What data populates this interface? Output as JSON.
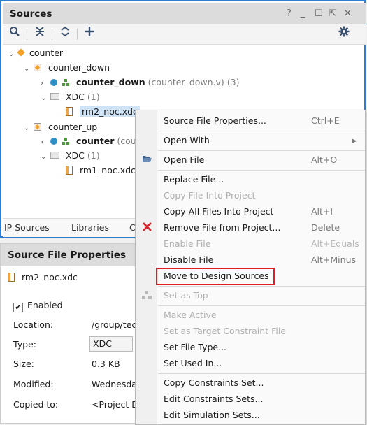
{
  "sources": {
    "title": "Sources",
    "header_controls": [
      "?",
      "_",
      "☐",
      "⇱",
      "✕"
    ],
    "toolbar_icons": [
      "search-icon",
      "collapse-all-icon",
      "expand-all-icon",
      "add-icon",
      "gear-icon"
    ],
    "tree": {
      "root": "counter",
      "counter_down": "counter_down",
      "counter_down_module": "counter_down",
      "counter_down_file": "(counter_down.v) (3)",
      "xdc1": "XDC",
      "xdc1_count": "(1)",
      "file1": "rm2_noc.xdc",
      "counter_up": "counter_up",
      "counter_up_module": "counter",
      "counter_up_file": "(coun",
      "xdc2": "XDC",
      "xdc2_count": "(1)",
      "file2": "rm1_noc.xdc"
    },
    "tabs": [
      "IP Sources",
      "Libraries",
      "C"
    ]
  },
  "properties": {
    "title": "Source File Properties",
    "file_name": "rm2_noc.xdc",
    "enabled_label": "Enabled",
    "enabled_checked": "✔",
    "location_label": "Location:",
    "location_value": "/group/tec",
    "type_label": "Type:",
    "type_value": "XDC",
    "size_label": "Size:",
    "size_value": "0.3 KB",
    "modified_label": "Modified:",
    "modified_value": "Wednesda",
    "copied_label": "Copied to:",
    "copied_value": "<Project D"
  },
  "context_menu": {
    "items": [
      {
        "label": "Source File Properties...",
        "shortcut": "Ctrl+E"
      },
      {
        "label": "Open With",
        "shortcut": "▸"
      },
      {
        "label": "Open File",
        "shortcut": "Alt+O"
      },
      {
        "label": "Replace File...",
        "shortcut": ""
      },
      {
        "label": "Copy File Into Project",
        "shortcut": ""
      },
      {
        "label": "Copy All Files Into Project",
        "shortcut": "Alt+I"
      },
      {
        "label": "Remove File from Project...",
        "shortcut": "Delete"
      },
      {
        "label": "Enable File",
        "shortcut": "Alt+Equals"
      },
      {
        "label": "Disable File",
        "shortcut": "Alt+Minus"
      },
      {
        "label": "Move to Design Sources",
        "shortcut": ""
      },
      {
        "label": "Set as Top",
        "shortcut": ""
      },
      {
        "label": "Make Active",
        "shortcut": ""
      },
      {
        "label": "Set as Target Constraint File",
        "shortcut": ""
      },
      {
        "label": "Set File Type...",
        "shortcut": ""
      },
      {
        "label": "Set Used In...",
        "shortcut": ""
      },
      {
        "label": "Copy Constraints Set...",
        "shortcut": ""
      },
      {
        "label": "Edit Constraints Sets...",
        "shortcut": ""
      },
      {
        "label": "Edit Simulation Sets...",
        "shortcut": ""
      }
    ],
    "highlight_color": "#e11d24",
    "remove_icon_color": "#e11d24"
  }
}
